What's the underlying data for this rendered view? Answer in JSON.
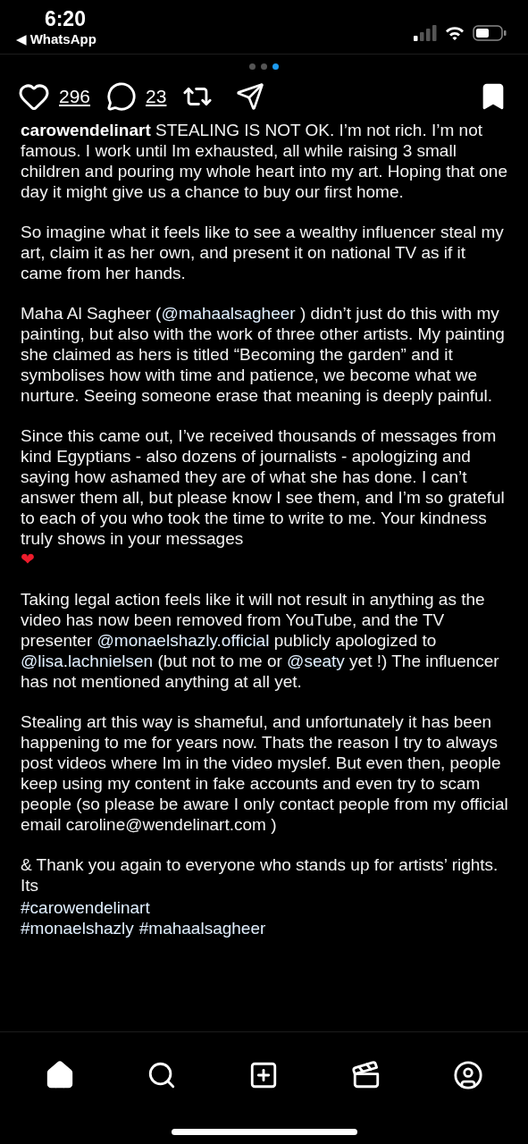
{
  "status_bar": {
    "time": "6:20",
    "back_label": "◀ WhatsApp"
  },
  "carousel": {
    "dots": [
      {
        "selected": false
      },
      {
        "selected": false
      },
      {
        "selected": true
      }
    ]
  },
  "actions": {
    "likes": "296",
    "comments": "23",
    "saved": true
  },
  "caption": {
    "paragraphs": [
      [
        {
          "kind": "username",
          "text": "carowendelinart"
        },
        {
          "kind": "text",
          "text": " STEALING IS NOT OK. I’m not rich. I’m not famous. I work until Im exhausted, all while raising 3 small children and pouring my whole heart into my art. Hoping that one day it might give us a chance to buy our first home."
        }
      ],
      [
        {
          "kind": "text",
          "text": "So imagine what it feels like to see a wealthy influencer steal my art, claim it as her own, and present it on national TV as if it came from her hands."
        }
      ],
      [
        {
          "kind": "text",
          "text": "Maha Al Sagheer ("
        },
        {
          "kind": "mention",
          "text": "@mahaalsagheer"
        },
        {
          "kind": "text",
          "text": " ) didn’t just do this with my painting, but also with the work of three other artists. My painting she claimed as hers is titled “Becoming the garden” and it symbolises how with time and patience, we become what we nurture. Seeing someone erase that meaning is deeply painful."
        }
      ],
      [
        {
          "kind": "text",
          "text": "Since this came out, I’ve received thousands of messages from kind Egyptians - also dozens of journalists - apologizing and saying how ashamed they are of what she has done. I can’t answer them all, but please know I see them, and I’m so grateful to each of you who took the time to write to me. Your kindness truly shows in your messages "
        },
        {
          "kind": "emoji",
          "text": "❤"
        }
      ],
      [
        {
          "kind": "text",
          "text": "Taking legal action feels like it will not result in anything as the video has now been removed from YouTube, and the TV presenter "
        },
        {
          "kind": "mention",
          "text": "@monaelshazly.official"
        },
        {
          "kind": "text",
          "text": " publicly apologized to "
        },
        {
          "kind": "mention",
          "text": "@lisa.lachnielsen"
        },
        {
          "kind": "text",
          "text": " (but not to me or "
        },
        {
          "kind": "mention",
          "text": "@seaty"
        },
        {
          "kind": "text",
          "text": " yet !) The influencer has not mentioned anything at all yet."
        }
      ],
      [
        {
          "kind": "text",
          "text": "Stealing art this way is shameful, and unfortunately it has been happening to me for years now. Thats the reason I try to always post videos where Im in the video myslef. But even then, people keep using my content in fake accounts and even try to scam people (so please be aware I only contact people from my official email caroline@wendelinart.com )"
        }
      ],
      [
        {
          "kind": "text",
          "text": "& Thank you again to everyone who stands up for artists’ rights. Its"
        }
      ]
    ],
    "hashtag_lines": [
      [
        "#carowendelinart"
      ],
      [
        "#monaelshazly",
        "#mahaalsagheer"
      ]
    ]
  },
  "tab_bar": {
    "items": [
      {
        "kind": "home",
        "selected": true
      },
      {
        "kind": "search",
        "selected": false
      },
      {
        "kind": "create",
        "selected": false
      },
      {
        "kind": "reels",
        "selected": false
      },
      {
        "kind": "profile",
        "selected": false
      }
    ]
  }
}
